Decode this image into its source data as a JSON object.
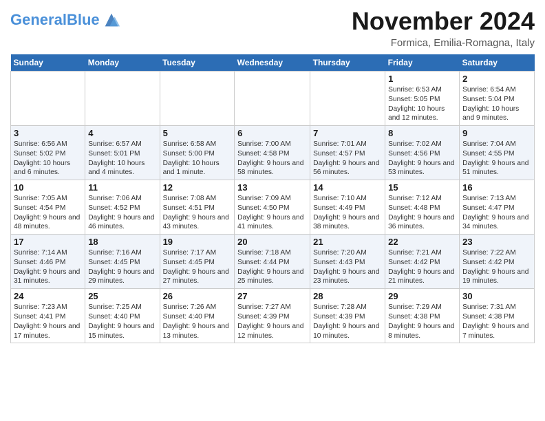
{
  "header": {
    "logo_general": "General",
    "logo_blue": "Blue",
    "month_year": "November 2024",
    "location": "Formica, Emilia-Romagna, Italy"
  },
  "days_of_week": [
    "Sunday",
    "Monday",
    "Tuesday",
    "Wednesday",
    "Thursday",
    "Friday",
    "Saturday"
  ],
  "weeks": [
    [
      {
        "day": "",
        "info": ""
      },
      {
        "day": "",
        "info": ""
      },
      {
        "day": "",
        "info": ""
      },
      {
        "day": "",
        "info": ""
      },
      {
        "day": "",
        "info": ""
      },
      {
        "day": "1",
        "info": "Sunrise: 6:53 AM\nSunset: 5:05 PM\nDaylight: 10 hours and 12 minutes."
      },
      {
        "day": "2",
        "info": "Sunrise: 6:54 AM\nSunset: 5:04 PM\nDaylight: 10 hours and 9 minutes."
      }
    ],
    [
      {
        "day": "3",
        "info": "Sunrise: 6:56 AM\nSunset: 5:02 PM\nDaylight: 10 hours and 6 minutes."
      },
      {
        "day": "4",
        "info": "Sunrise: 6:57 AM\nSunset: 5:01 PM\nDaylight: 10 hours and 4 minutes."
      },
      {
        "day": "5",
        "info": "Sunrise: 6:58 AM\nSunset: 5:00 PM\nDaylight: 10 hours and 1 minute."
      },
      {
        "day": "6",
        "info": "Sunrise: 7:00 AM\nSunset: 4:58 PM\nDaylight: 9 hours and 58 minutes."
      },
      {
        "day": "7",
        "info": "Sunrise: 7:01 AM\nSunset: 4:57 PM\nDaylight: 9 hours and 56 minutes."
      },
      {
        "day": "8",
        "info": "Sunrise: 7:02 AM\nSunset: 4:56 PM\nDaylight: 9 hours and 53 minutes."
      },
      {
        "day": "9",
        "info": "Sunrise: 7:04 AM\nSunset: 4:55 PM\nDaylight: 9 hours and 51 minutes."
      }
    ],
    [
      {
        "day": "10",
        "info": "Sunrise: 7:05 AM\nSunset: 4:54 PM\nDaylight: 9 hours and 48 minutes."
      },
      {
        "day": "11",
        "info": "Sunrise: 7:06 AM\nSunset: 4:52 PM\nDaylight: 9 hours and 46 minutes."
      },
      {
        "day": "12",
        "info": "Sunrise: 7:08 AM\nSunset: 4:51 PM\nDaylight: 9 hours and 43 minutes."
      },
      {
        "day": "13",
        "info": "Sunrise: 7:09 AM\nSunset: 4:50 PM\nDaylight: 9 hours and 41 minutes."
      },
      {
        "day": "14",
        "info": "Sunrise: 7:10 AM\nSunset: 4:49 PM\nDaylight: 9 hours and 38 minutes."
      },
      {
        "day": "15",
        "info": "Sunrise: 7:12 AM\nSunset: 4:48 PM\nDaylight: 9 hours and 36 minutes."
      },
      {
        "day": "16",
        "info": "Sunrise: 7:13 AM\nSunset: 4:47 PM\nDaylight: 9 hours and 34 minutes."
      }
    ],
    [
      {
        "day": "17",
        "info": "Sunrise: 7:14 AM\nSunset: 4:46 PM\nDaylight: 9 hours and 31 minutes."
      },
      {
        "day": "18",
        "info": "Sunrise: 7:16 AM\nSunset: 4:45 PM\nDaylight: 9 hours and 29 minutes."
      },
      {
        "day": "19",
        "info": "Sunrise: 7:17 AM\nSunset: 4:45 PM\nDaylight: 9 hours and 27 minutes."
      },
      {
        "day": "20",
        "info": "Sunrise: 7:18 AM\nSunset: 4:44 PM\nDaylight: 9 hours and 25 minutes."
      },
      {
        "day": "21",
        "info": "Sunrise: 7:20 AM\nSunset: 4:43 PM\nDaylight: 9 hours and 23 minutes."
      },
      {
        "day": "22",
        "info": "Sunrise: 7:21 AM\nSunset: 4:42 PM\nDaylight: 9 hours and 21 minutes."
      },
      {
        "day": "23",
        "info": "Sunrise: 7:22 AM\nSunset: 4:42 PM\nDaylight: 9 hours and 19 minutes."
      }
    ],
    [
      {
        "day": "24",
        "info": "Sunrise: 7:23 AM\nSunset: 4:41 PM\nDaylight: 9 hours and 17 minutes."
      },
      {
        "day": "25",
        "info": "Sunrise: 7:25 AM\nSunset: 4:40 PM\nDaylight: 9 hours and 15 minutes."
      },
      {
        "day": "26",
        "info": "Sunrise: 7:26 AM\nSunset: 4:40 PM\nDaylight: 9 hours and 13 minutes."
      },
      {
        "day": "27",
        "info": "Sunrise: 7:27 AM\nSunset: 4:39 PM\nDaylight: 9 hours and 12 minutes."
      },
      {
        "day": "28",
        "info": "Sunrise: 7:28 AM\nSunset: 4:39 PM\nDaylight: 9 hours and 10 minutes."
      },
      {
        "day": "29",
        "info": "Sunrise: 7:29 AM\nSunset: 4:38 PM\nDaylight: 9 hours and 8 minutes."
      },
      {
        "day": "30",
        "info": "Sunrise: 7:31 AM\nSunset: 4:38 PM\nDaylight: 9 hours and 7 minutes."
      }
    ]
  ]
}
